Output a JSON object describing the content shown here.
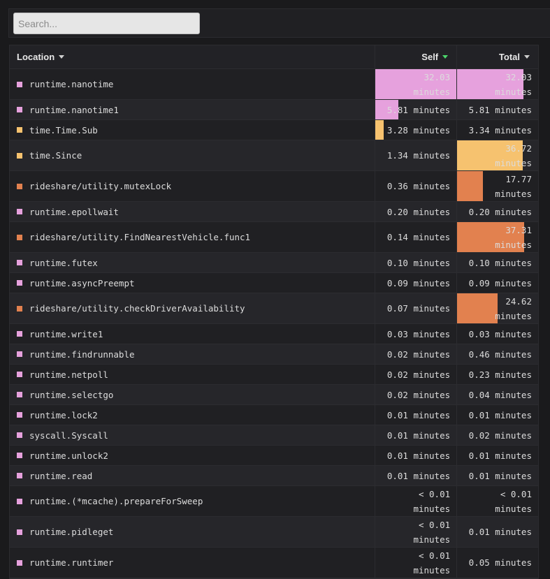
{
  "search": {
    "placeholder": "Search..."
  },
  "columns": {
    "location": "Location",
    "self": "Self",
    "total": "Total"
  },
  "palette": {
    "pink": "#e6a1dd",
    "yellow": "#f6c26f",
    "orange": "#e2814f",
    "sort_active": "#4bd66b"
  },
  "rows": [
    {
      "name": "runtime.nanotime",
      "color": "#e6a1dd",
      "self": "32.03 minutes",
      "total": "32.03 minutes",
      "self_fill": 1.0,
      "total_fill": 0.82
    },
    {
      "name": "runtime.nanotime1",
      "color": "#e6a1dd",
      "self": "5.81 minutes",
      "total": "5.81 minutes",
      "self_fill": 0.28,
      "total_fill": 0.0
    },
    {
      "name": "time.Time.Sub",
      "color": "#f6c26f",
      "self": "3.28 minutes",
      "total": "3.34 minutes",
      "self_fill": 0.1,
      "total_fill": 0.0
    },
    {
      "name": "time.Since",
      "color": "#f6c26f",
      "self": "1.34 minutes",
      "total": "36.72 minutes",
      "self_fill": 0.0,
      "total_fill": 0.81
    },
    {
      "name": "rideshare/utility.mutexLock",
      "color": "#e2814f",
      "self": "0.36 minutes",
      "total": "17.77 minutes",
      "self_fill": 0.0,
      "total_fill": 0.32
    },
    {
      "name": "runtime.epollwait",
      "color": "#e6a1dd",
      "self": "0.20 minutes",
      "total": "0.20 minutes",
      "self_fill": 0.0,
      "total_fill": 0.0
    },
    {
      "name": "rideshare/utility.FindNearestVehicle.func1",
      "color": "#e2814f",
      "self": "0.14 minutes",
      "total": "37.31 minutes",
      "self_fill": 0.0,
      "total_fill": 0.83
    },
    {
      "name": "runtime.futex",
      "color": "#e6a1dd",
      "self": "0.10 minutes",
      "total": "0.10 minutes",
      "self_fill": 0.0,
      "total_fill": 0.0
    },
    {
      "name": "runtime.asyncPreempt",
      "color": "#e6a1dd",
      "self": "0.09 minutes",
      "total": "0.09 minutes",
      "self_fill": 0.0,
      "total_fill": 0.0
    },
    {
      "name": "rideshare/utility.checkDriverAvailability",
      "color": "#e2814f",
      "self": "0.07 minutes",
      "total": "24.62 minutes",
      "self_fill": 0.0,
      "total_fill": 0.5
    },
    {
      "name": "runtime.write1",
      "color": "#e6a1dd",
      "self": "0.03 minutes",
      "total": "0.03 minutes",
      "self_fill": 0.0,
      "total_fill": 0.0
    },
    {
      "name": "runtime.findrunnable",
      "color": "#e6a1dd",
      "self": "0.02 minutes",
      "total": "0.46 minutes",
      "self_fill": 0.0,
      "total_fill": 0.0
    },
    {
      "name": "runtime.netpoll",
      "color": "#e6a1dd",
      "self": "0.02 minutes",
      "total": "0.23 minutes",
      "self_fill": 0.0,
      "total_fill": 0.0
    },
    {
      "name": "runtime.selectgo",
      "color": "#e6a1dd",
      "self": "0.02 minutes",
      "total": "0.04 minutes",
      "self_fill": 0.0,
      "total_fill": 0.0
    },
    {
      "name": "runtime.lock2",
      "color": "#e6a1dd",
      "self": "0.01 minutes",
      "total": "0.01 minutes",
      "self_fill": 0.0,
      "total_fill": 0.0
    },
    {
      "name": "syscall.Syscall",
      "color": "#e6a1dd",
      "self": "0.01 minutes",
      "total": "0.02 minutes",
      "self_fill": 0.0,
      "total_fill": 0.0
    },
    {
      "name": "runtime.unlock2",
      "color": "#e6a1dd",
      "self": "0.01 minutes",
      "total": "0.01 minutes",
      "self_fill": 0.0,
      "total_fill": 0.0
    },
    {
      "name": "runtime.read",
      "color": "#e6a1dd",
      "self": "0.01 minutes",
      "total": "0.01 minutes",
      "self_fill": 0.0,
      "total_fill": 0.0
    },
    {
      "name": "runtime.(*mcache).prepareForSweep",
      "color": "#e6a1dd",
      "self": "< 0.01 minutes",
      "total": "< 0.01 minutes",
      "self_fill": 0.0,
      "total_fill": 0.0
    },
    {
      "name": "runtime.pidleget",
      "color": "#e6a1dd",
      "self": "< 0.01 minutes",
      "total": "0.01 minutes",
      "self_fill": 0.0,
      "total_fill": 0.0
    },
    {
      "name": "runtime.runtimer",
      "color": "#e6a1dd",
      "self": "< 0.01 minutes",
      "total": "0.05 minutes",
      "self_fill": 0.0,
      "total_fill": 0.0
    }
  ]
}
